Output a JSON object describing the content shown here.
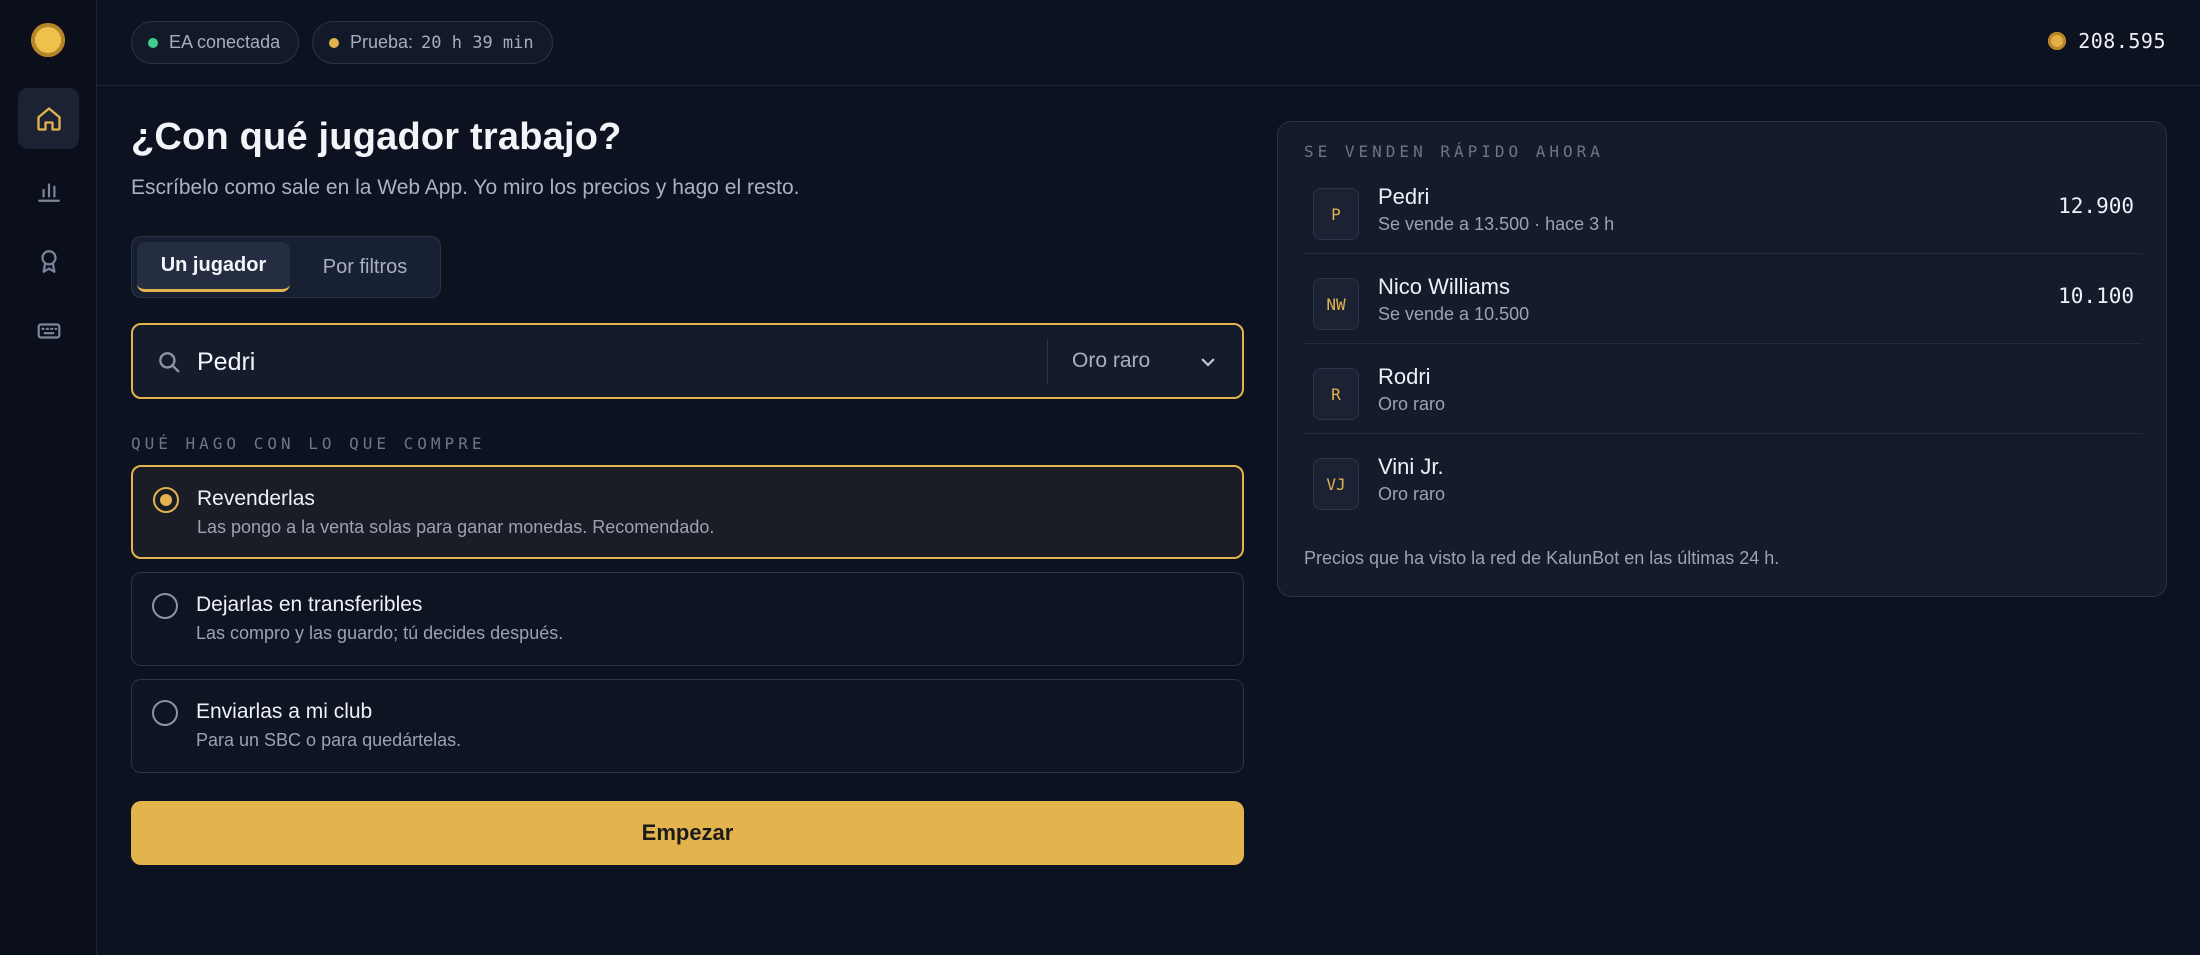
{
  "app": {
    "nav": [
      {
        "icon": "home-icon",
        "active": true
      },
      {
        "icon": "bar-chart-icon",
        "active": false
      },
      {
        "icon": "award-icon",
        "active": false
      },
      {
        "icon": "keyboard-icon",
        "active": false
      }
    ]
  },
  "topbar": {
    "ea_status": "EA conectada",
    "trial_label": "Prueba:",
    "trial_time": "20 h 39 min",
    "coins": "208.595"
  },
  "main": {
    "title": "¿Con qué jugador trabajo?",
    "subtitle": "Escríbelo como sale en la Web App. Yo miro los precios y hago el resto.",
    "tabs": [
      "Un jugador",
      "Por filtros"
    ],
    "search_value": "Pedri",
    "quality_select": "Oro raro",
    "section_label": "QUÉ HAGO CON LO QUE COMPRE",
    "options": [
      {
        "title": "Revenderlas",
        "desc": "Las pongo a la venta solas para ganar monedas. Recomendado.",
        "selected": true
      },
      {
        "title": "Dejarlas en transferibles",
        "desc": "Las compro y las guardo; tú decides después.",
        "selected": false
      },
      {
        "title": "Enviarlas a mi club",
        "desc": "Para un SBC o para quedártelas.",
        "selected": false
      }
    ],
    "start_label": "Empezar"
  },
  "panel": {
    "label": "SE VENDEN RÁPIDO AHORA",
    "players": [
      {
        "initials": "P",
        "name": "Pedri",
        "sub": "Se vende a 13.500 · hace 3 h",
        "price": "12.900"
      },
      {
        "initials": "NW",
        "name": "Nico Williams",
        "sub": "Se vende a 10.500",
        "price": "10.100"
      },
      {
        "initials": "R",
        "name": "Rodri",
        "sub": "Oro raro",
        "price": ""
      },
      {
        "initials": "VJ",
        "name": "Vini Jr.",
        "sub": "Oro raro",
        "price": ""
      }
    ],
    "footer": "Precios que ha visto la red de KalunBot en las últimas 24 h."
  },
  "colors": {
    "accent": "#e3b34e",
    "background": "#0d1220",
    "status_green": "#3ecf8e"
  }
}
